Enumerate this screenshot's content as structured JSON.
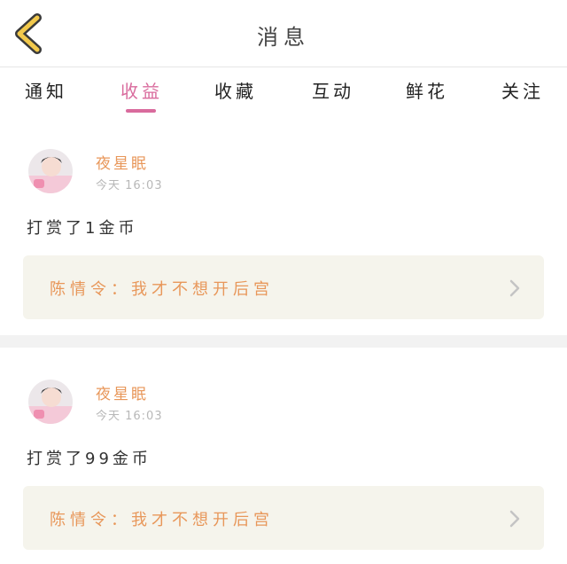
{
  "header": {
    "title": "消息"
  },
  "tabs": [
    {
      "label": "通知",
      "active": false
    },
    {
      "label": "收益",
      "active": true
    },
    {
      "label": "收藏",
      "active": false
    },
    {
      "label": "互动",
      "active": false
    },
    {
      "label": "鲜花",
      "active": false
    },
    {
      "label": "关注",
      "active": false
    }
  ],
  "messages": [
    {
      "user": "夜星眠",
      "time": "今天 16:03",
      "text": "打赏了1金币",
      "quote": "陈情令：我才不想开后宫"
    },
    {
      "user": "夜星眠",
      "time": "今天 16:03",
      "text": "打赏了99金币",
      "quote": "陈情令：我才不想开后宫"
    }
  ],
  "colors": {
    "accent": "#d96b9d",
    "name": "#e8975a",
    "back_icon": "#f2c94c",
    "quote_bg": "#f5f4ec"
  },
  "icons": {
    "back": "chevron-left-icon",
    "arrow": "chevron-right-icon"
  }
}
